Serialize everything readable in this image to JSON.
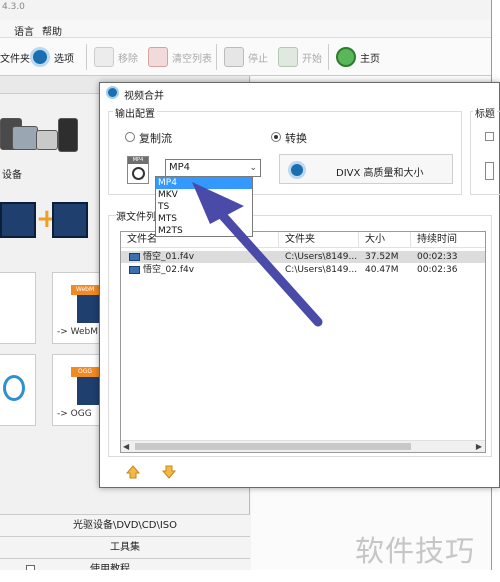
{
  "app": {
    "version_text": "4.3.0",
    "menu": {
      "language": "语言",
      "help": "帮助"
    },
    "toolbar": {
      "output_folder": "文件夹",
      "options": "选项",
      "remove": "移除",
      "clear_list": "清空列表",
      "stop": "停止",
      "start": "开始",
      "home": "主页"
    },
    "left_panel": {
      "header": "",
      "devices_label": "设备",
      "joiner_label": "",
      "tile_webm": "-> WebM",
      "tile_ogg": "-> OGG",
      "tile_ogg_badge": "OGG",
      "tile_webm_badge": "WebM",
      "optical_row": "光驱设备\\DVD\\CD\\ISO",
      "tools_row": "工具集",
      "bottom_row": "使用教程"
    }
  },
  "dialog": {
    "title": "视频合并",
    "output_group": {
      "label": "输出配置",
      "copy_stream": "复制流",
      "convert": "转换",
      "selected_format": "MP4",
      "preset_label": "DIVX 高质量和大小",
      "icon_label": "MP4"
    },
    "format_options": [
      "MP4",
      "MKV",
      "TS",
      "MTS",
      "M2TS"
    ],
    "right_group": {
      "label": "标题"
    },
    "source_list": {
      "label": "源文件列表",
      "columns": [
        "文件名",
        "文件夹",
        "大小",
        "持续时间"
      ],
      "rows": [
        {
          "name": "悟空_01.f4v",
          "folder": "C:\\Users\\8149...",
          "size": "37.52M",
          "duration": "00:02:33"
        },
        {
          "name": "悟空_02.f4v",
          "folder": "C:\\Users\\8149...",
          "size": "40.47M",
          "duration": "00:02:36"
        }
      ]
    }
  },
  "annotation": {
    "arrow_color": "#4a4aa8"
  },
  "watermark": "软件技巧"
}
